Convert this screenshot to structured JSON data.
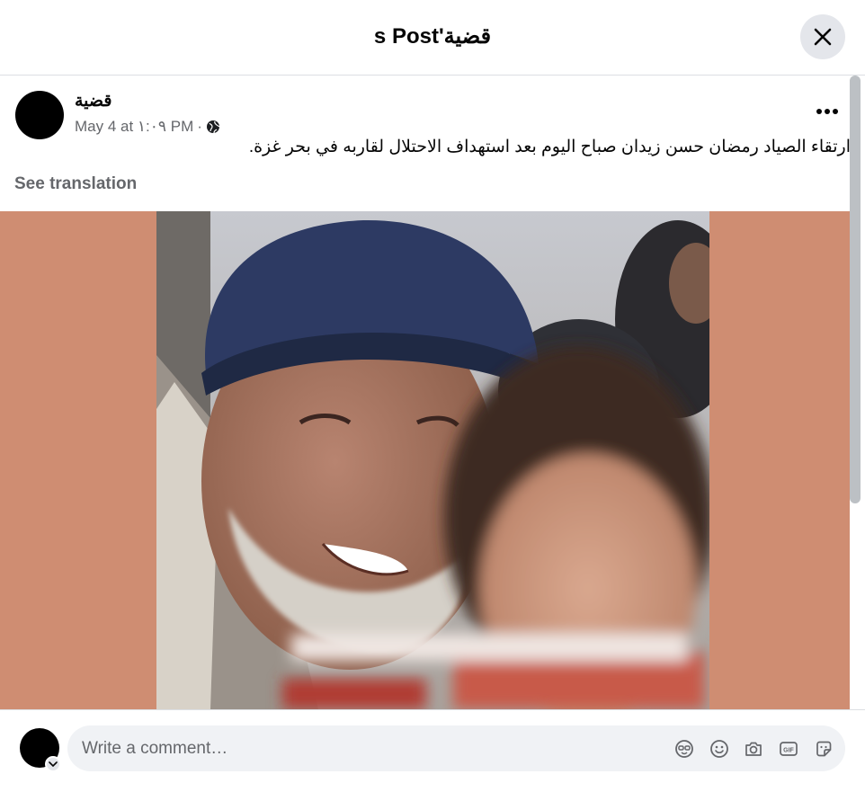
{
  "header": {
    "title": "s Post'قضية",
    "close_icon": "close-icon"
  },
  "post": {
    "author": "قضية",
    "date": "May 4 at ١:٠٩ PM",
    "separator": "·",
    "audience_icon": "globe-icon",
    "more_icon": "more-horizontal-icon",
    "text": "ارتقاء الصياد رمضان حسن زيدان صباح اليوم بعد استهداف الاحتلال لقاربه في بحر غزة.",
    "see_translation": "See translation"
  },
  "comment": {
    "placeholder": "Write a comment…",
    "icons": [
      "avatar-sticker-icon",
      "emoji-icon",
      "camera-icon",
      "gif-icon",
      "sticker-icon"
    ]
  },
  "colors": {
    "photo_background": "#cf8d72",
    "secondary_text": "#65676b",
    "button_bg": "#e4e6eb",
    "input_bg": "#f0f2f5"
  }
}
